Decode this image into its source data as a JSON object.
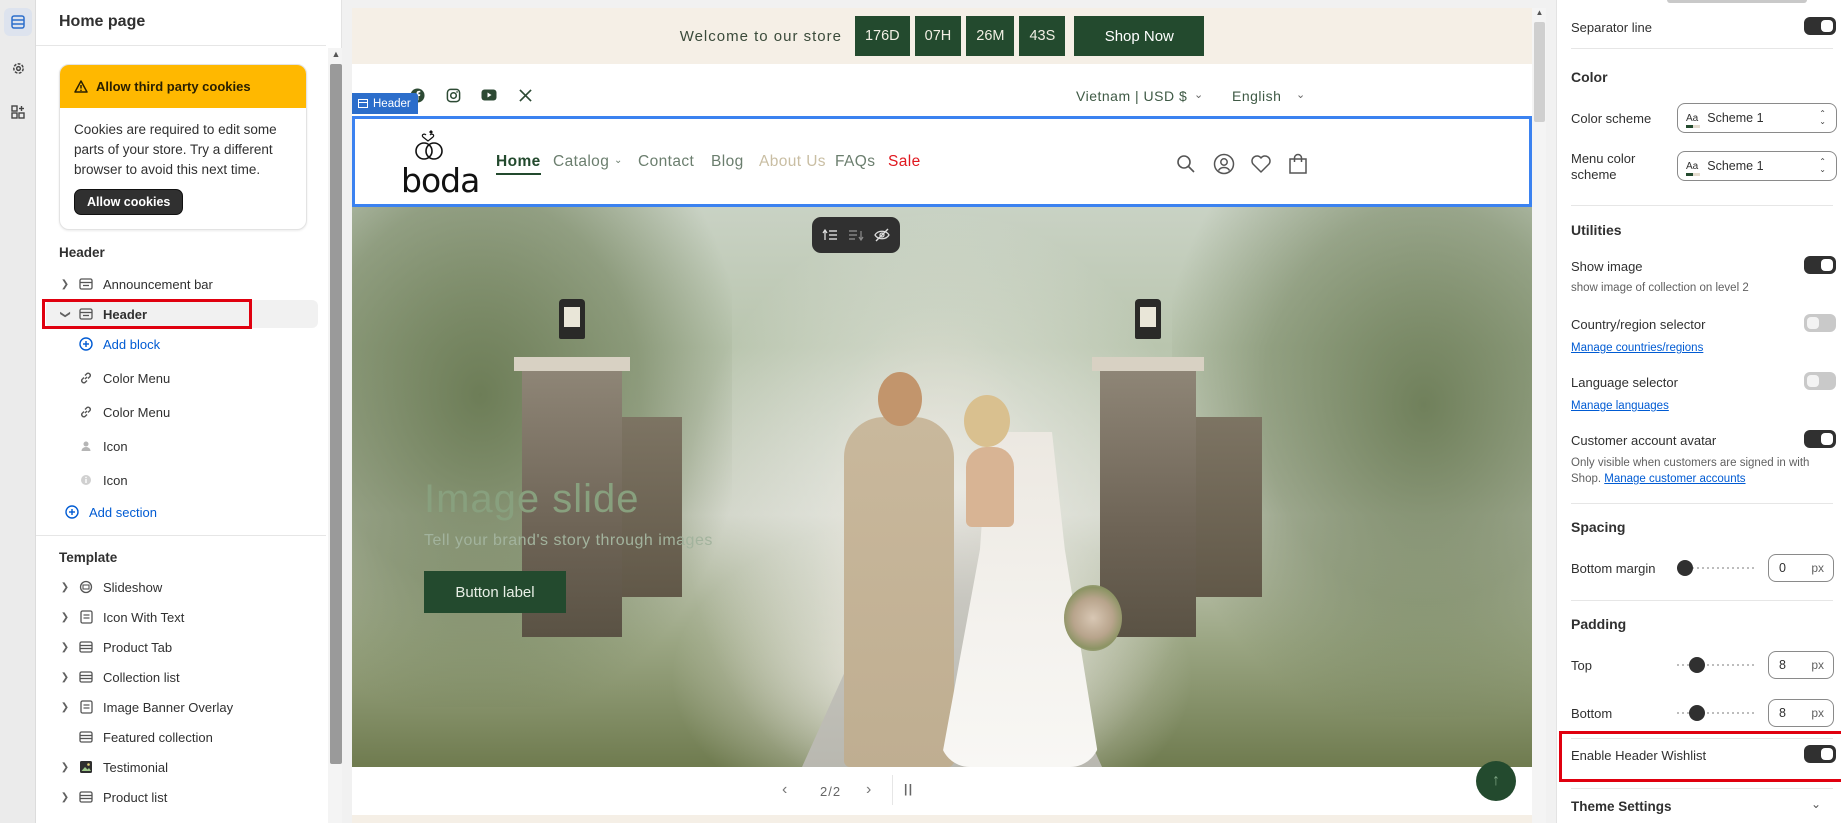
{
  "sidebar": {
    "title": "Home page",
    "cookie": {
      "heading": "Allow third party cookies",
      "body": "Cookies are required to edit some parts of your store. Try a different browser to avoid this next time.",
      "button": "Allow cookies"
    },
    "header_group": {
      "title": "Header",
      "items": [
        {
          "label": "Announcement bar"
        },
        {
          "label": "Header"
        },
        {
          "label": "Add block"
        },
        {
          "label": "Color Menu"
        },
        {
          "label": "Color Menu"
        },
        {
          "label": "Icon"
        },
        {
          "label": "Icon"
        },
        {
          "label": "Add section"
        }
      ]
    },
    "template_group": {
      "title": "Template",
      "items": [
        {
          "label": "Slideshow"
        },
        {
          "label": "Icon With Text"
        },
        {
          "label": "Product Tab"
        },
        {
          "label": "Collection list"
        },
        {
          "label": "Image Banner Overlay"
        },
        {
          "label": "Featured collection"
        },
        {
          "label": "Testimonial"
        },
        {
          "label": "Product list"
        }
      ]
    }
  },
  "preview": {
    "announcement": {
      "text": "Welcome to our store",
      "countdown": [
        "176D",
        "07H",
        "26M",
        "43S"
      ],
      "shop_now": "Shop Now"
    },
    "utility": {
      "region": "Vietnam  |  USD $",
      "language": "English"
    },
    "header_tag": "Header",
    "logo_text": "boda",
    "nav": [
      "Home",
      "Catalog",
      "Contact",
      "Blog",
      "About Us",
      "FAQs",
      "Sale"
    ],
    "hero": {
      "title": "Image slide",
      "subtitle": "Tell your brand's story through images",
      "button": "Button label"
    },
    "slider": {
      "counter": "2/2"
    }
  },
  "settings": {
    "separator_line": "Separator line",
    "color_heading": "Color",
    "color_scheme_label": "Color scheme",
    "color_scheme_value": "Scheme 1",
    "menu_color_scheme_label": "Menu color scheme",
    "menu_color_scheme_value": "Scheme 1",
    "utilities_heading": "Utilities",
    "show_image_label": "Show image",
    "show_image_help": "show image of collection on level 2",
    "country_label": "Country/region selector",
    "country_link": "Manage countries/regions",
    "language_label": "Language selector",
    "language_link": "Manage languages",
    "avatar_label": "Customer account avatar",
    "avatar_help": "Only visible when customers are signed in with Shop.",
    "avatar_link": "Manage customer accounts",
    "spacing_heading": "Spacing",
    "bottom_margin_label": "Bottom margin",
    "bottom_margin_value": "0",
    "padding_heading": "Padding",
    "top_label": "Top",
    "top_value": "8",
    "bottom_label": "Bottom",
    "bottom_value": "8",
    "unit": "px",
    "wishlist_label": "Enable Header Wishlist",
    "theme_settings": "Theme Settings"
  }
}
